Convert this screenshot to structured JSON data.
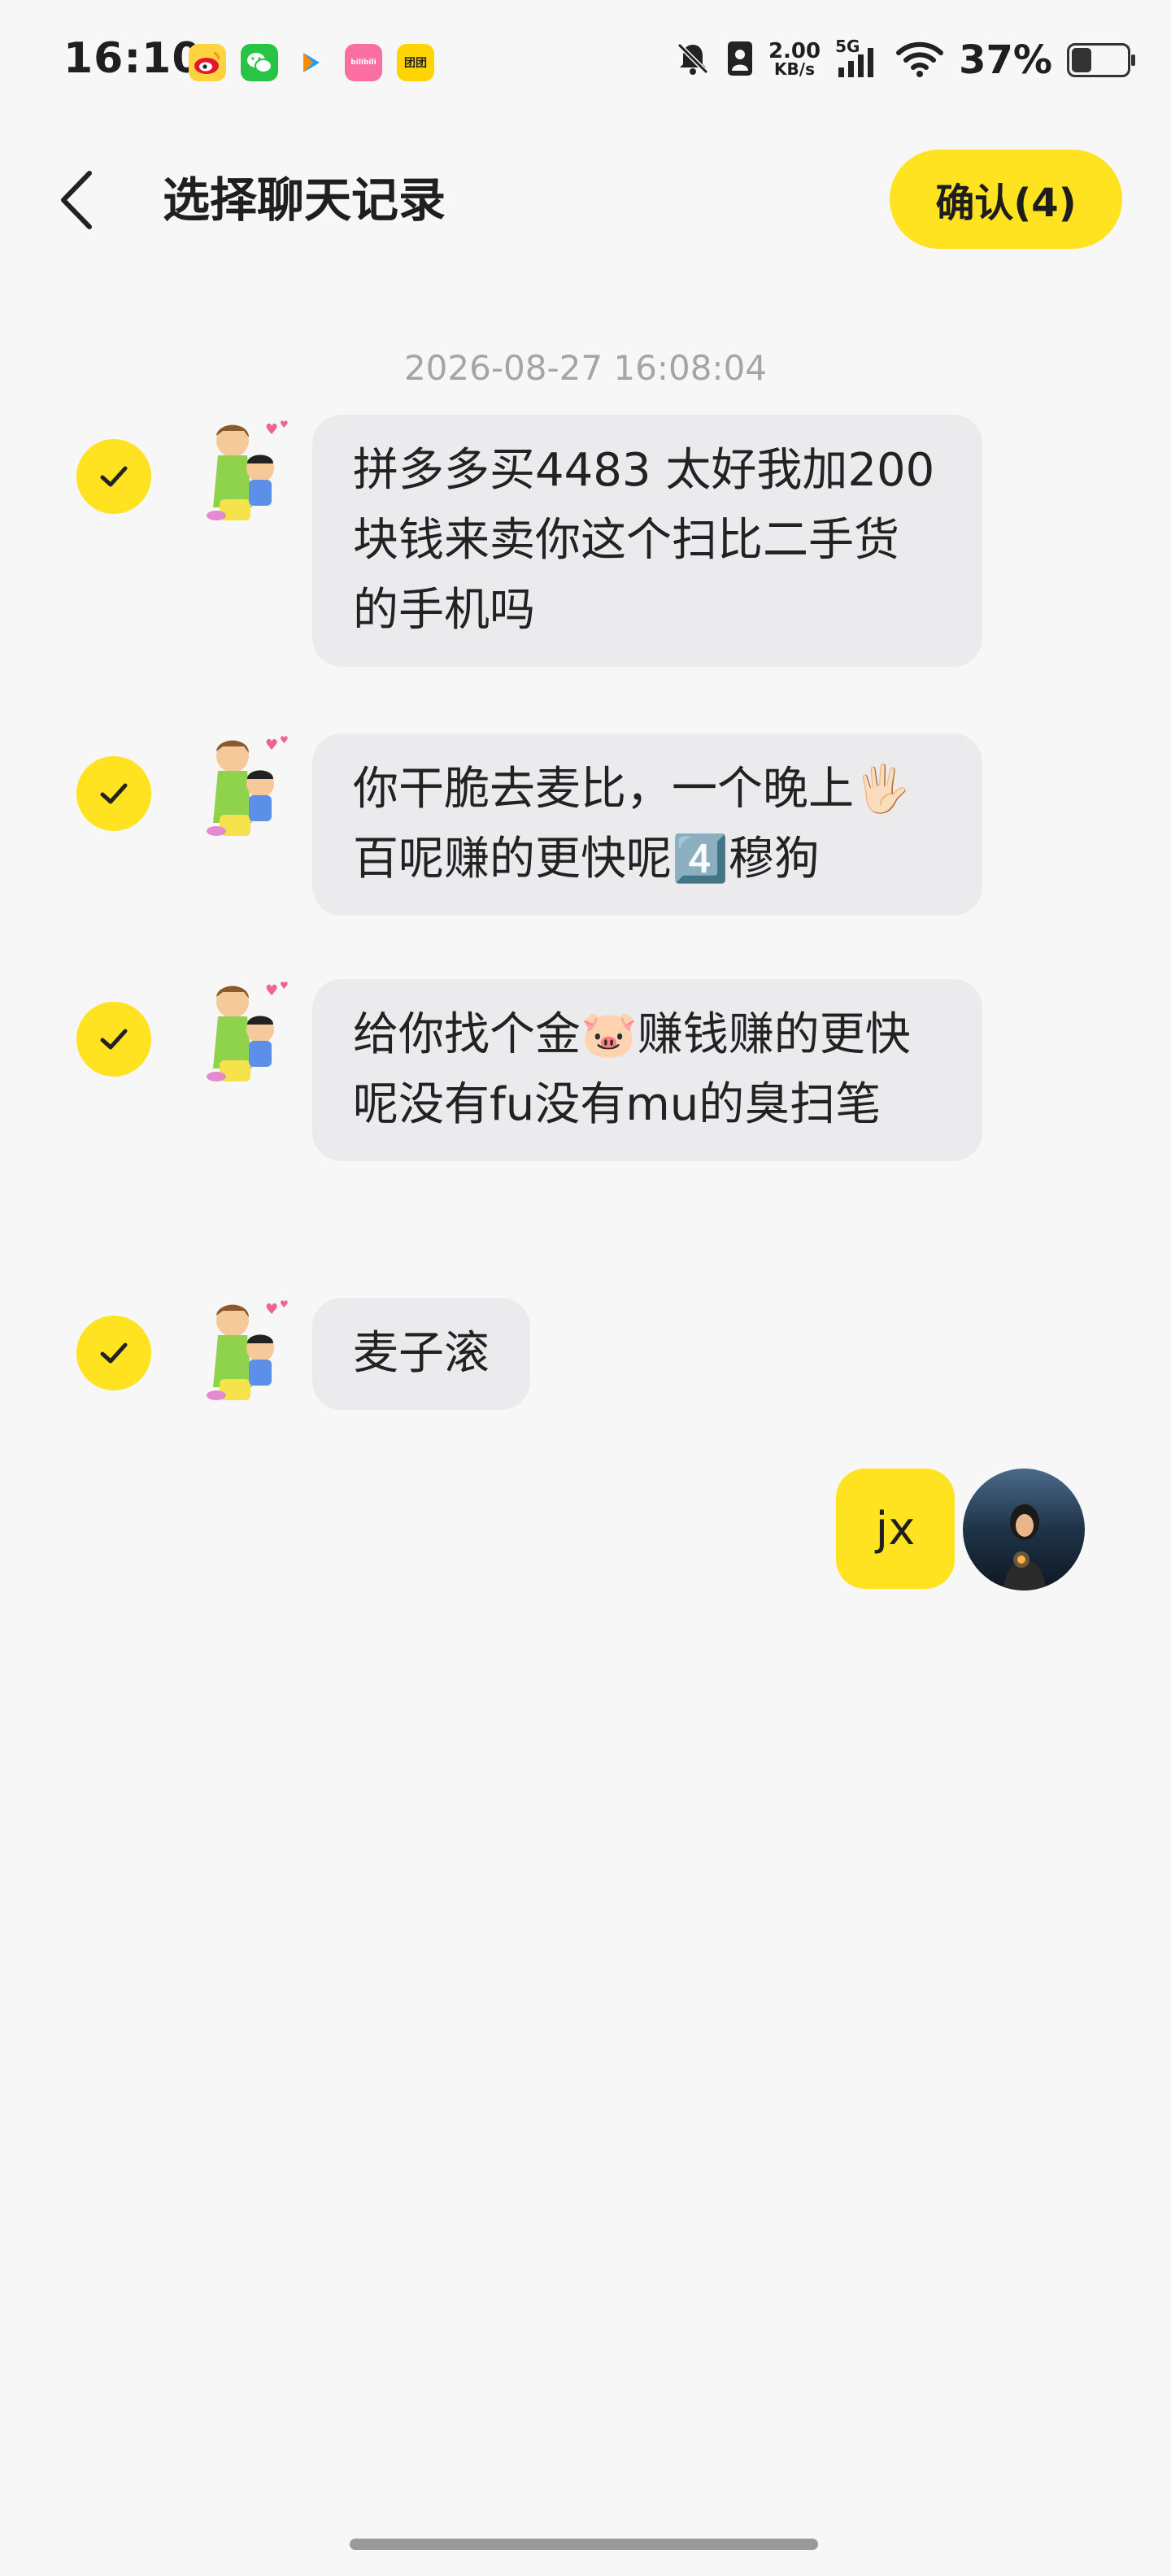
{
  "status_bar": {
    "time": "16:10",
    "app_icons": [
      "weibo-icon",
      "wechat-icon",
      "video-icon",
      "bilibili-icon",
      "tuantuan-icon"
    ],
    "bili_label": "bilibili",
    "tuan_label": "团团",
    "net_speed_value": "2.00",
    "net_speed_unit": "KB/s",
    "network": "5G",
    "battery_percent": "37%",
    "battery_level": 0.37
  },
  "header": {
    "title": "选择聊天记录",
    "confirm_label": "确认(4)"
  },
  "timestamp": "2026-08-27 16:08:04",
  "messages": [
    {
      "text": "拼多多买4483 太好我加200块钱来卖你这个扫比二手货的手机吗",
      "checked": true
    },
    {
      "text": "你干脆去麦比，一个晚上🖐🏻百呢赚的更快呢4️⃣穆狗",
      "checked": true
    },
    {
      "text": "给你找个金🐷赚钱赚的更快呢没有fu没有mu的臭扫笔",
      "checked": true
    },
    {
      "text": "麦子滚",
      "checked": true
    }
  ],
  "own_message": {
    "text": "jx"
  },
  "colors": {
    "accent": "#ffe220",
    "background": "#f7f7f8",
    "bubble_other": "#ebebed",
    "timestamp": "#a5a5a5"
  }
}
